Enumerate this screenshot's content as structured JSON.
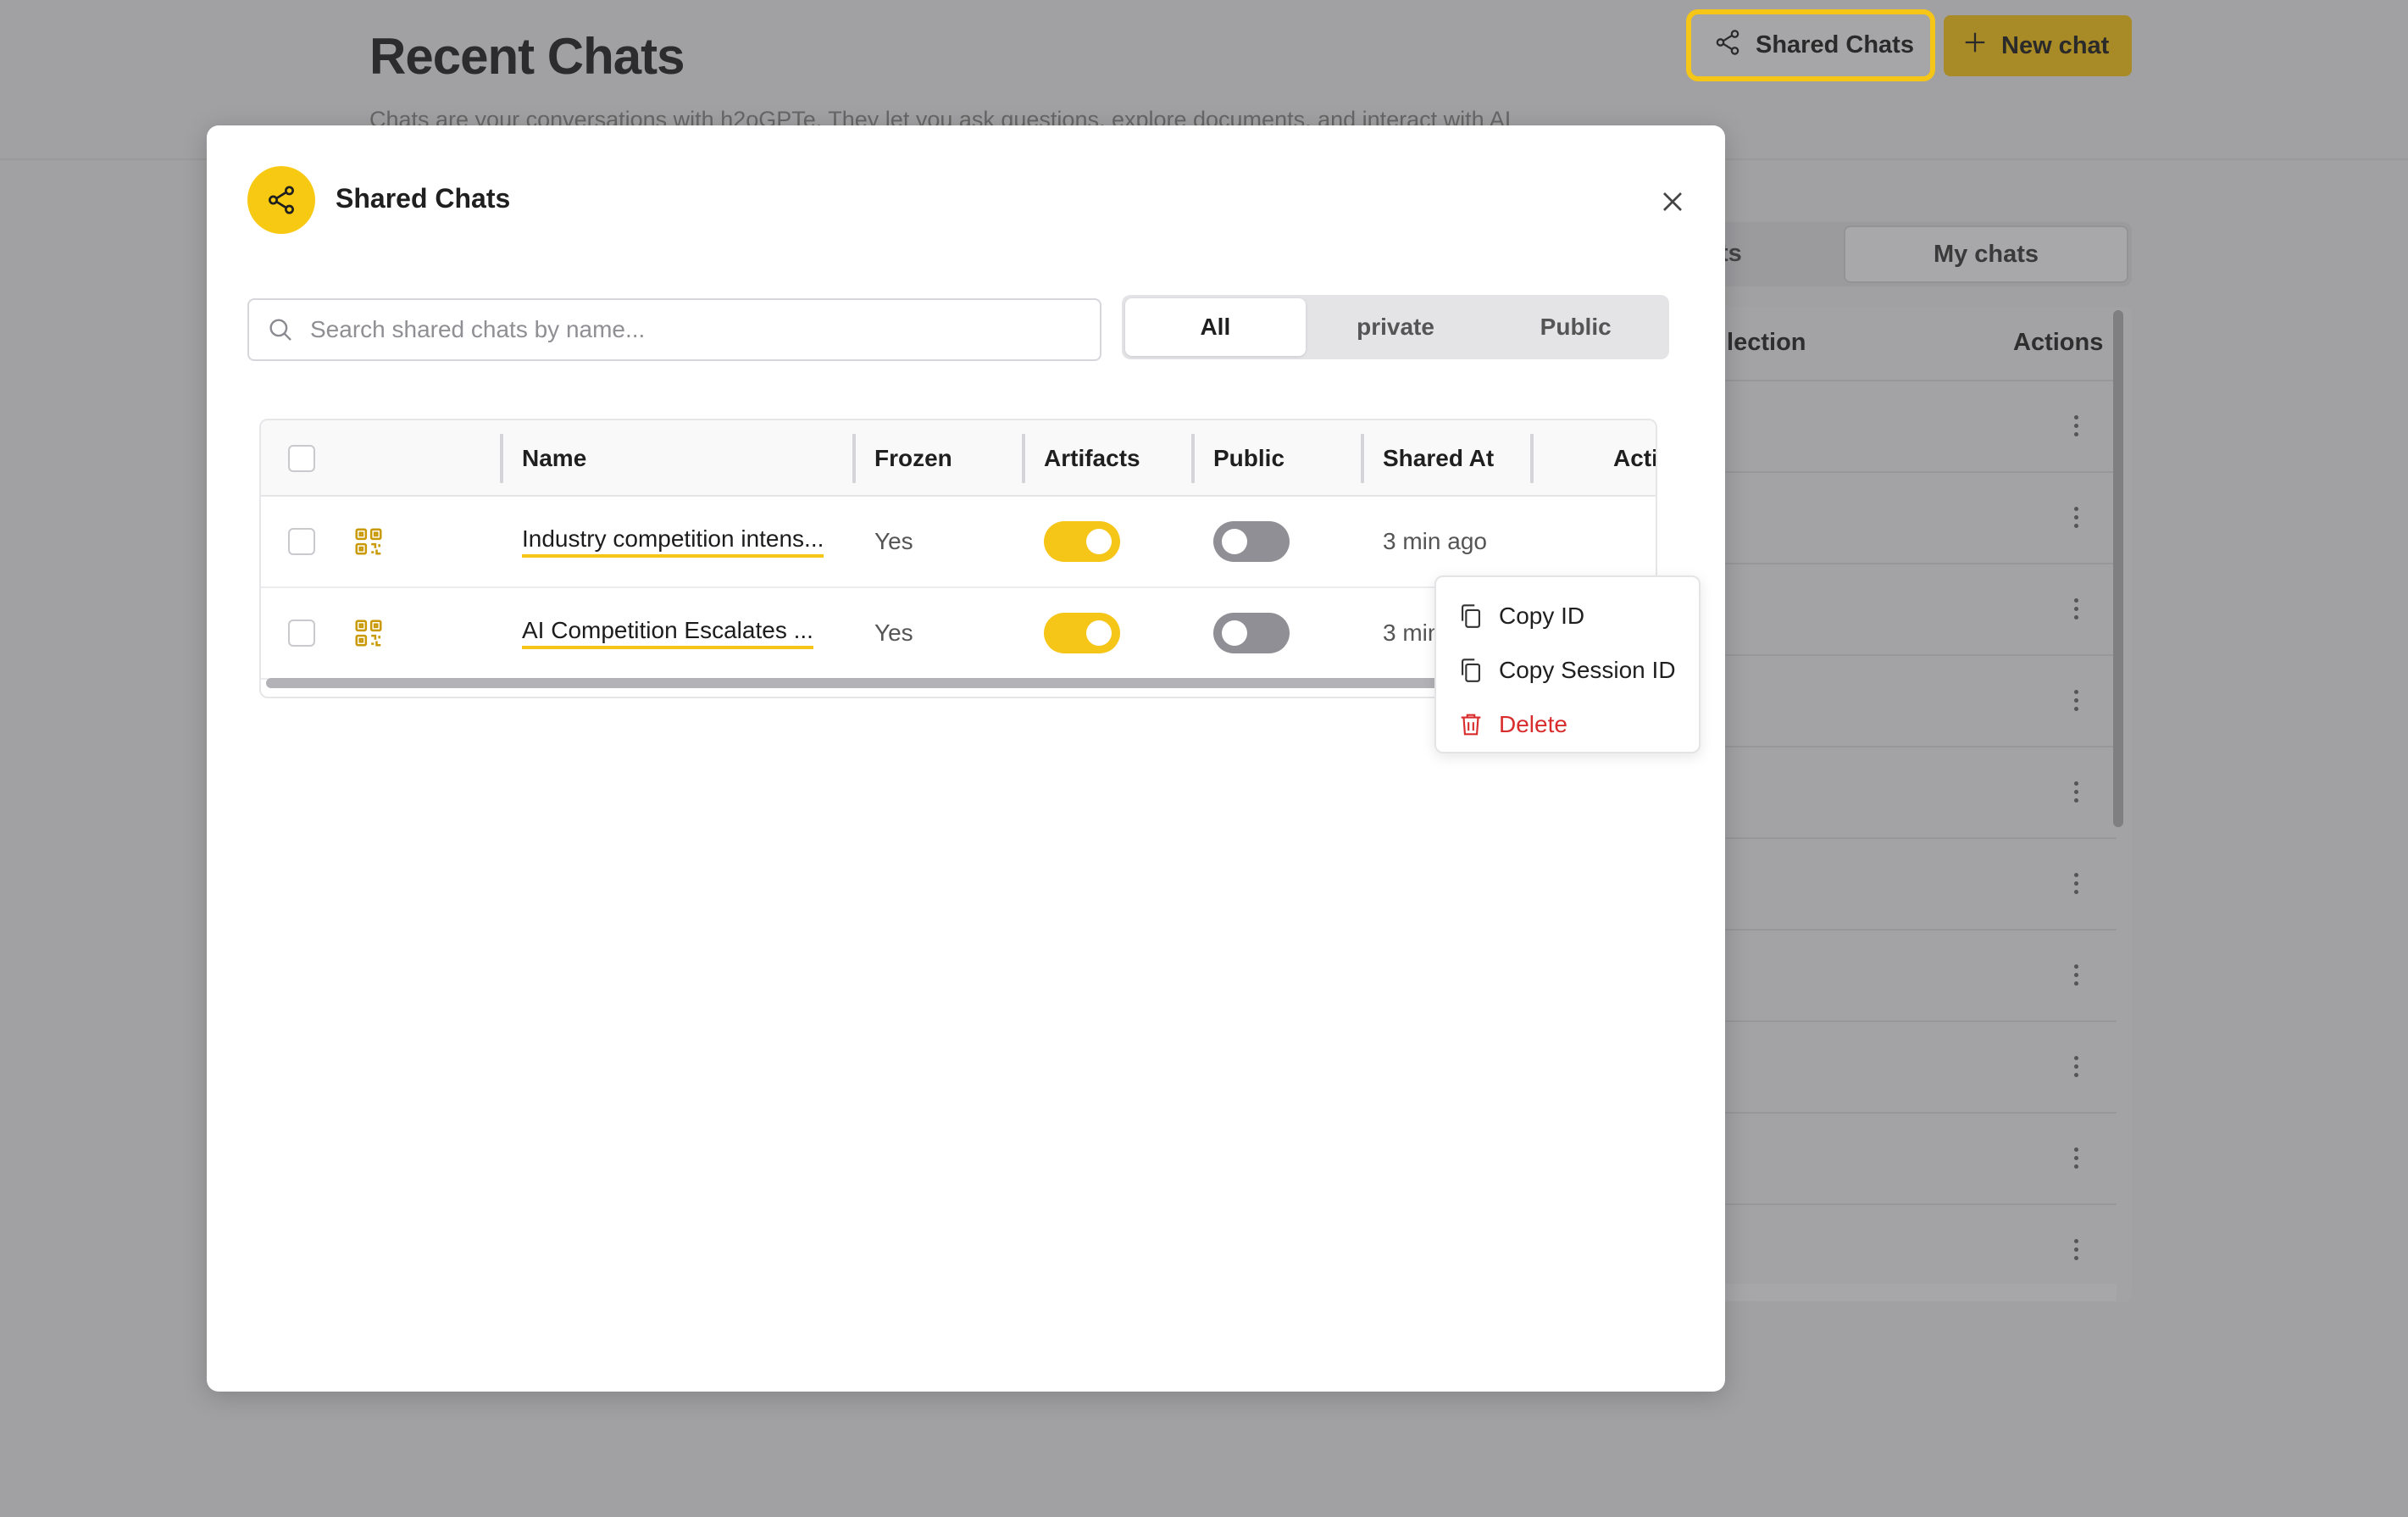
{
  "page": {
    "title": "Recent Chats",
    "subtitle": "Chats are your conversations with h2oGPTe. They let you ask questions, explore documents, and interact with AI"
  },
  "header": {
    "shared_chats_label": "Shared Chats",
    "new_chat_label": "New chat"
  },
  "background": {
    "tab_shared_partial": "ts",
    "tab_my_chats": "My chats",
    "col_collection_partial": "llection",
    "col_actions": "Actions",
    "row_count": 10
  },
  "modal": {
    "title": "Shared Chats",
    "search_placeholder": "Search shared chats by name...",
    "filters": [
      "All",
      "private",
      "Public"
    ],
    "active_filter": "All",
    "columns": {
      "name": "Name",
      "frozen": "Frozen",
      "artifacts": "Artifacts",
      "public": "Public",
      "shared_at": "Shared At",
      "actions_partial": "Acti"
    },
    "rows": [
      {
        "name": "Industry competition intens...",
        "frozen": "Yes",
        "artifacts": true,
        "public": false,
        "shared_at": "3 min ago"
      },
      {
        "name": "AI Competition Escalates ...",
        "frozen": "Yes",
        "artifacts": true,
        "public": false,
        "shared_at": "3 min ago"
      }
    ]
  },
  "context_menu": {
    "copy_id": "Copy ID",
    "copy_session_id": "Copy Session ID",
    "delete": "Delete"
  },
  "colors": {
    "accent": "#f5c518",
    "danger": "#d92d2d",
    "overlay": "#a1a1a3"
  }
}
